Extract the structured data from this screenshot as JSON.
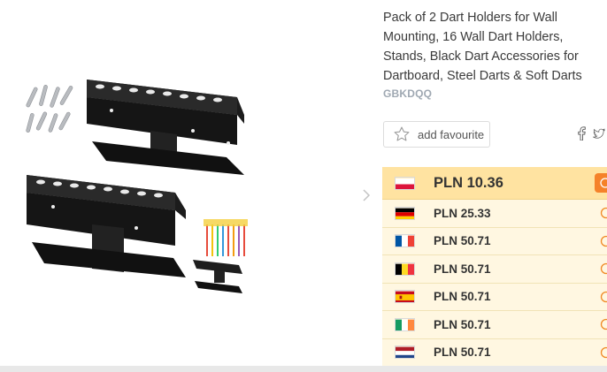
{
  "product": {
    "title": "Pack of 2 Dart Holders for Wall Mounting, 16 Wall Dart Holders, Stands, Black Dart Accessories for Dartboard, Steel Darts & Soft Darts",
    "brand": "GBKDQQ"
  },
  "gallery": {
    "image_icon": "dart-holder-product-image",
    "next_icon": "chevron-right-icon"
  },
  "actions": {
    "favourite_label": "add favourite",
    "share_icons": [
      "facebook-icon",
      "twitter-icon"
    ]
  },
  "prices": [
    {
      "country": "Poland",
      "flag": "pl",
      "price": "PLN 10.36",
      "best": true
    },
    {
      "country": "Germany",
      "flag": "de",
      "price": "PLN 25.33",
      "best": false
    },
    {
      "country": "France",
      "flag": "fr",
      "price": "PLN 50.71",
      "best": false
    },
    {
      "country": "Belgium",
      "flag": "be",
      "price": "PLN 50.71",
      "best": false
    },
    {
      "country": "Spain",
      "flag": "es",
      "price": "PLN 50.71",
      "best": false
    },
    {
      "country": "Ireland",
      "flag": "ie",
      "price": "PLN 50.71",
      "best": false
    },
    {
      "country": "Netherlands",
      "flag": "nl",
      "price": "PLN 50.71",
      "best": false
    }
  ],
  "colors": {
    "accent": "#f5822a",
    "best_row": "#ffe3a1",
    "row": "#fff7e1",
    "brand_text": "#9fa8b2"
  }
}
